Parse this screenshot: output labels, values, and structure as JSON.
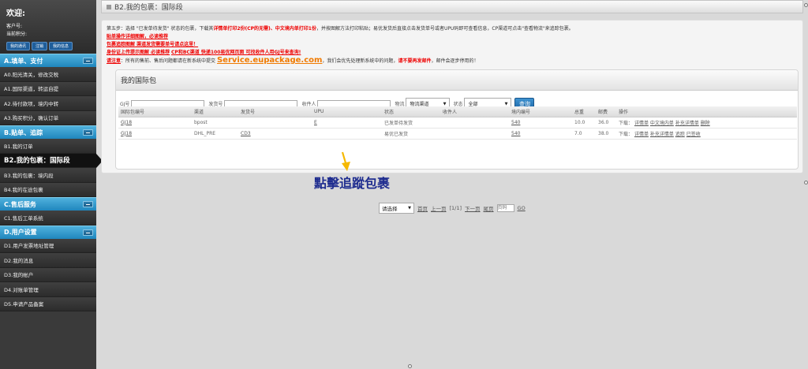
{
  "sidebar": {
    "welcome_title": "欢迎:",
    "customer_label": "客户号:",
    "points_label": "当前积分:",
    "buttons": [
      "我的通讯",
      "注销",
      "我的信息"
    ],
    "sections": [
      {
        "title": "A.填单、支付",
        "items": [
          "A0.阳光清关，修改交税",
          "A1.国际渠道，转运自提",
          "A2.待付款项，境内中转",
          "A3.购买积分，确认订单"
        ]
      },
      {
        "title": "B.贴单、追踪",
        "items": [
          "B1.我的订单",
          "B2.我的包裹：国际段",
          "B3.我的包裹：境内段",
          "B4.我的在途包裹"
        ],
        "active_index": 1
      },
      {
        "title": "C.售后服务",
        "items": [
          "C1.售后工单系统"
        ]
      },
      {
        "title": "D.用户设置",
        "items": [
          "D1.用户发票地址管理",
          "D2.我的消息",
          "D3.我的帐户",
          "D4.对账单管理",
          "D5.申请产品备案"
        ]
      }
    ]
  },
  "topbar": {
    "title": "B2.我的包裹：国际段"
  },
  "instructions": {
    "line1_a": "第五步：选择 \"已发单待发货\" 状态的包裹，下载其",
    "line1_b": "详情单打印2份(CP的无需)、中文境内单打印1份",
    "line1_c": "，并按图解方法打印粘贴；易优发货后直接点击发货单号或者UPU码即可查看信息，CP渠道可点击\"查看物流\"来追踪包裹。",
    "line2": "贴单操作详细图解，必读推荐",
    "line3": "包裹追踪图解 渠道发货需要单号请点这里！",
    "line4_a": "身份证上传提示图解 必读推荐",
    "line4_b": "CP和BC渠道 快递100易优网页面 可找收件人用GJ号来查询!",
    "line5_a": "请注意",
    "line5_b": "：所有的售前、售后问题都请在新系统中提交",
    "line5_c": "Service.eupackage.com",
    "line5_d": "，我们会优先处理新系统中的问题，",
    "line5_e": "请不要再发邮件",
    "line5_f": "，邮件会逐步停用的！"
  },
  "box": {
    "title": "我的国际包",
    "filters": {
      "gj_label": "GJ号",
      "ship_label": "发货号",
      "recipient_label": "收件人",
      "logistics_label": "物流",
      "logistics_value": "物流渠道",
      "status_label": "状态",
      "status_value": "全部",
      "query_button": "查询"
    },
    "columns": [
      "国际包编号",
      "渠道",
      "发货号",
      "UPU",
      "状态",
      "收件人",
      "境内编号",
      "总重",
      "邮费",
      "操作"
    ],
    "rows": [
      {
        "id": "GJ18",
        "channel": "bpost",
        "ship": "",
        "upu": "E",
        "status": "已发单待发货",
        "recipient": "",
        "domestic": "540",
        "weight": "10.0",
        "fee": "36.0",
        "ops_label": "下载：",
        "ops": [
          "详情单",
          "中文境内单",
          "补充详情单",
          "删除"
        ]
      },
      {
        "id": "GJ18",
        "channel": "DHL_PRE",
        "ship": "CD3",
        "upu": "",
        "status": "易优已发货",
        "recipient": "",
        "domestic": "540",
        "weight": "7.0",
        "fee": "38.0",
        "ops_label": "下载：",
        "ops": [
          "详情单",
          "补充详情单",
          "追踪",
          "已签收"
        ]
      }
    ]
  },
  "pager": {
    "select_label": "请选择",
    "first": "首页",
    "prev": "上一页",
    "info": "[1/1]",
    "next": "下一页",
    "last": "尾页",
    "page_placeholder": "页码",
    "go": "GO"
  },
  "annotation": {
    "text": "點擊追蹤包裹",
    "arrow_color": "#f5b800"
  }
}
